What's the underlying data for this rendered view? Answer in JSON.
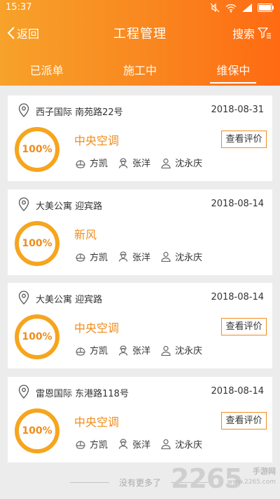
{
  "status_bar": {
    "time": "15:37",
    "icons": [
      "mute-icon",
      "wifi-icon",
      "signal-icon",
      "battery-icon"
    ]
  },
  "navbar": {
    "back_label": "返回",
    "title": "工程管理",
    "search_label": "搜索"
  },
  "tabs": [
    {
      "label": "已派单",
      "active": false
    },
    {
      "label": "施工中",
      "active": false
    },
    {
      "label": "维保中",
      "active": true
    }
  ],
  "cards": [
    {
      "address": "西子国际 南苑路22号",
      "date": "2018-08-31",
      "progress": "100%",
      "type": "中央空调",
      "review_label": "查看评价",
      "staff": [
        "方凯",
        "张洋",
        "沈永庆"
      ]
    },
    {
      "address": "大美公寓 迎宾路",
      "date": "2018-08-14",
      "progress": "100%",
      "type": "新风",
      "review_label": "",
      "staff": [
        "方凯",
        "张洋",
        "沈永庆"
      ]
    },
    {
      "address": "大美公寓 迎宾路",
      "date": "2018-08-14",
      "progress": "100%",
      "type": "中央空调",
      "review_label": "查看评价",
      "staff": [
        "方凯",
        "张洋",
        "沈永庆"
      ]
    },
    {
      "address": "雷恩国际 东港路118号",
      "date": "2018-08-14",
      "progress": "100%",
      "type": "中央空调",
      "review_label": "查看评价",
      "staff": [
        "方凯",
        "张洋",
        "沈永庆"
      ]
    }
  ],
  "footer": {
    "text": "没有更多了"
  },
  "watermark": {
    "number": "2265",
    "suffix": "手游网",
    "url": "www.2265.com"
  },
  "colors": {
    "accent": "#f08c1b",
    "ring": "#f6a51e",
    "header_start": "#f7a22a",
    "header_end": "#ff6a12"
  }
}
